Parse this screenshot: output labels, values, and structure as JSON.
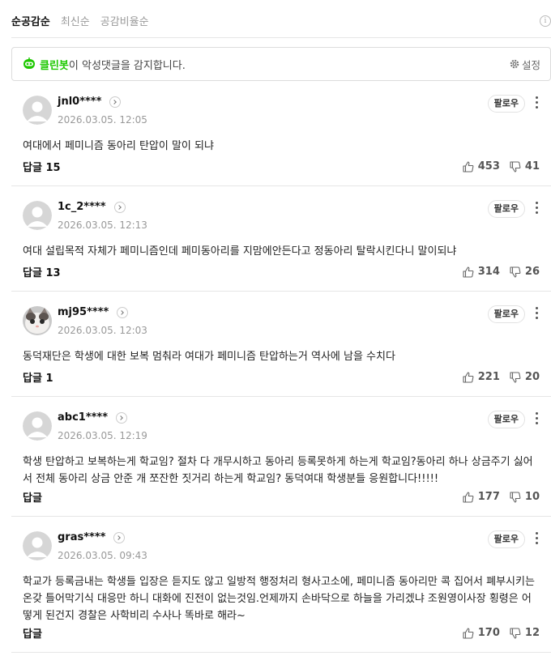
{
  "tabs": [
    "순공감순",
    "최신순",
    "공감비율순"
  ],
  "cleanbot": {
    "brand": "클린봇",
    "text": "이 악성댓글을 감지합니다.",
    "settings": "설정"
  },
  "follow_label": "팔로우",
  "comments": [
    {
      "nick": "jnl0****",
      "date": "2026.03.05. 12:05",
      "text": "여대에서 페미니즘 동아리 탄압이 말이 되냐",
      "reply": "답글 15",
      "likes": "453",
      "dislikes": "41",
      "avatar": "default"
    },
    {
      "nick": "1c_2****",
      "date": "2026.03.05. 12:13",
      "text": "여대 설립목적 자체가 페미니즘인데 페미동아리를 지맘에안든다고 정동아리 탈락시킨다니 말이되냐",
      "reply": "답글 13",
      "likes": "314",
      "dislikes": "26",
      "avatar": "default"
    },
    {
      "nick": "mj95****",
      "date": "2026.03.05. 12:03",
      "text": "동덕재단은 학생에 대한 보복 멈춰라 여대가 페미니즘 탄압하는거 역사에 남을 수치다",
      "reply": "답글 1",
      "likes": "221",
      "dislikes": "20",
      "avatar": "cat"
    },
    {
      "nick": "abc1****",
      "date": "2026.03.05. 12:19",
      "text": "학생 탄압하고 보복하는게 학교임? 절차 다 개무시하고 동아리 등록못하게 하는게 학교임?동아리 하나 상금주기 싫어서 전체 동아리 상금 안준 개 쪼잔한 짓거리 하는게 학교임? 동덕여대 학생분들 응원합니다!!!!!",
      "reply": "답글",
      "likes": "177",
      "dislikes": "10",
      "avatar": "default"
    },
    {
      "nick": "gras****",
      "date": "2026.03.05. 09:43",
      "text": "학교가 등록금내는 학생들 입장은 듣지도 않고 일방적 행정처리 형사고소에, 페미니즘 동아리만 콕 집어서 폐부시키는 온갖 틀어막기식 대응만 하니 대화에 진전이 없는것임.언제까지 손바닥으로 하늘을 가리겠냐 조원영이사장 횡령은 어떻게 된건지 경찰은 사학비리 수사나 똑바로 해라~",
      "reply": "답글",
      "likes": "170",
      "dislikes": "12",
      "avatar": "default"
    }
  ]
}
